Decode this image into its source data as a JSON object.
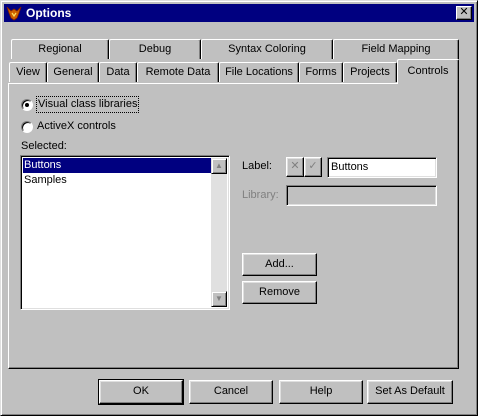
{
  "window": {
    "title": "Options",
    "close_glyph": "✕"
  },
  "tabs": {
    "row1": [
      "Regional",
      "Debug",
      "Syntax Coloring",
      "Field Mapping"
    ],
    "row2": [
      "View",
      "General",
      "Data",
      "Remote Data",
      "File Locations",
      "Forms",
      "Projects",
      "Controls"
    ],
    "active": "Controls"
  },
  "controls": {
    "radio_visual": {
      "label": "Visual class libraries",
      "checked": true
    },
    "radio_activex": {
      "label": "ActiveX controls",
      "checked": false
    },
    "selected_label": "Selected:",
    "selected_items": [
      "Buttons",
      "Samples"
    ],
    "selected_current": "Buttons",
    "label_field": {
      "caption": "Label:",
      "value": "Buttons"
    },
    "library_field": {
      "caption": "Library:",
      "value": ""
    },
    "cancel_glyph": "✕",
    "confirm_glyph": "✓",
    "add_button": "Add...",
    "remove_button": "Remove"
  },
  "footer": {
    "ok": "OK",
    "cancel": "Cancel",
    "help": "Help",
    "set_default": "Set As Default"
  }
}
